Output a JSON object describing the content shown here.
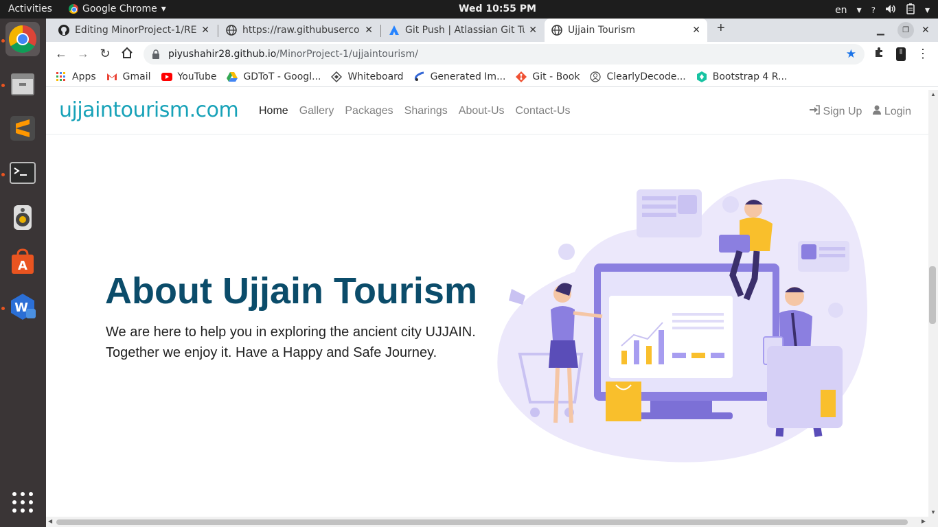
{
  "topbar": {
    "activities": "Activities",
    "app_name": "Google Chrome",
    "clock": "Wed 10:55 PM",
    "lang": "en"
  },
  "dock": {
    "items": [
      "chrome-icon",
      "files-icon",
      "sublime-text-icon",
      "terminal-icon",
      "audio-player-icon",
      "software-center-icon",
      "wps-office-icon",
      "app-grid-icon"
    ]
  },
  "tabs": [
    {
      "label": "Editing MinorProject-1/RE",
      "icon": "github-icon"
    },
    {
      "label": "https://raw.githubuserco",
      "icon": "globe-icon"
    },
    {
      "label": "Git Push | Atlassian Git Tu",
      "icon": "atlassian-icon"
    },
    {
      "label": "Ujjain Tourism",
      "icon": "globe-icon",
      "active": true
    }
  ],
  "omnibox": {
    "host": "piyushahir28.github.io",
    "path": "/MinorProject-1/ujjaintourism/"
  },
  "bookmarks": [
    {
      "label": "Apps",
      "icon": "apps-grid-icon"
    },
    {
      "label": "Gmail",
      "icon": "gmail-icon"
    },
    {
      "label": "YouTube",
      "icon": "youtube-icon"
    },
    {
      "label": "GDToT - Googl...",
      "icon": "google-drive-icon"
    },
    {
      "label": "Whiteboard",
      "icon": "whiteboard-icon"
    },
    {
      "label": "Generated Im...",
      "icon": "generated-images-icon"
    },
    {
      "label": "Git - Book",
      "icon": "git-icon"
    },
    {
      "label": "ClearlyDecode...",
      "icon": "clearlydecoded-icon"
    },
    {
      "label": "Bootstrap 4 R...",
      "icon": "bootstrap-icon"
    }
  ],
  "site": {
    "brand": "ujjaintourism.com",
    "nav": [
      "Home",
      "Gallery",
      "Packages",
      "Sharings",
      "About-Us",
      "Contact-Us"
    ],
    "signup": "Sign Up",
    "login": "Login"
  },
  "hero": {
    "title": "About Ujjain Tourism",
    "text_line1": "We are here to help you in exploring the ancient city UJJAIN.",
    "text_line2": "Together we enjoy it. Have a Happy and Safe Journey."
  },
  "colors": {
    "brand": "#17a2b8",
    "title": "#0b4c6a",
    "illustration_bg": "#ece8fb",
    "illustration_accent": "#8b7fe0",
    "illustration_yellow": "#f9bf2c",
    "star": "#1a73e8"
  }
}
